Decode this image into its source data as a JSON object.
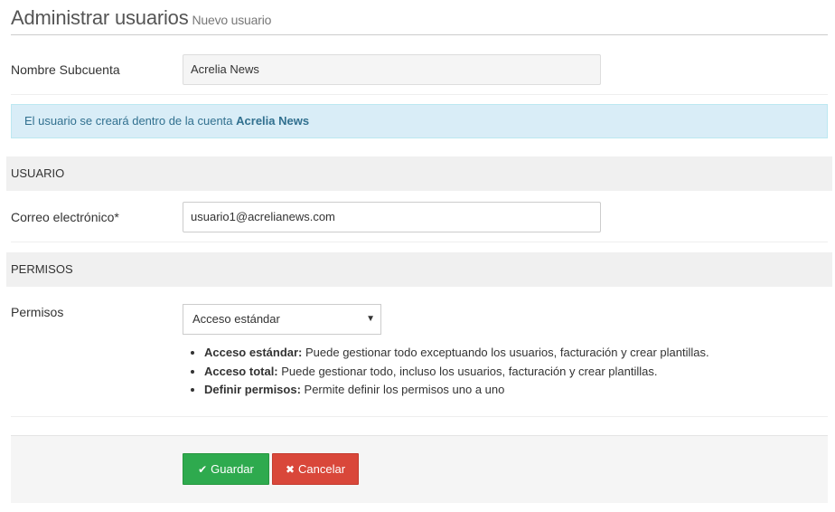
{
  "header": {
    "title": "Administrar usuarios",
    "subtitle": "Nuevo usuario"
  },
  "subaccount": {
    "label": "Nombre Subcuenta",
    "value": "Acrelia News"
  },
  "alert": {
    "text": "El usuario se creará dentro de la cuenta ",
    "account": "Acrelia News"
  },
  "section_user": {
    "title": "USUARIO"
  },
  "email": {
    "label": "Correo electrónico*",
    "value": "usuario1@acrelianews.com"
  },
  "section_permissions": {
    "title": "PERMISOS"
  },
  "permissions": {
    "label": "Permisos",
    "selected": "Acceso estándar",
    "help": [
      {
        "term": "Acceso estándar:",
        "desc": " Puede gestionar todo exceptuando los usuarios, facturación y crear plantillas."
      },
      {
        "term": "Acceso total:",
        "desc": " Puede gestionar todo, incluso los usuarios, facturación y crear plantillas."
      },
      {
        "term": "Definir permisos:",
        "desc": " Permite definir los permisos uno a uno"
      }
    ]
  },
  "actions": {
    "save_label": "Guardar",
    "cancel_label": "Cancelar"
  },
  "colors": {
    "save": "#2eaa4e",
    "cancel": "#d9473a",
    "alert_bg": "#d9edf7"
  },
  "icons": {
    "save": "check-icon",
    "cancel": "times-icon",
    "select_caret": "caret-down-icon"
  }
}
